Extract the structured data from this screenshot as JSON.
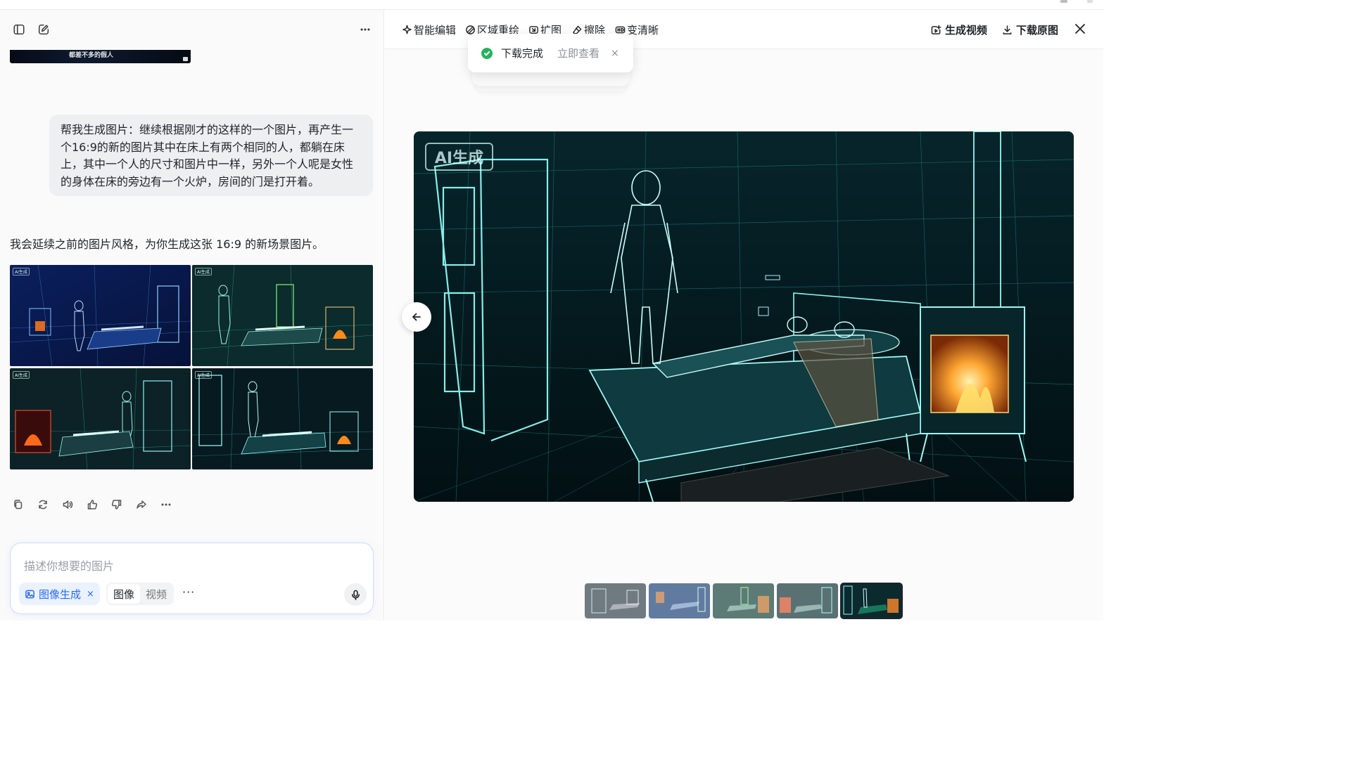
{
  "left": {
    "prev_thumb_caption": "都差不多的假人",
    "user_message": "帮我生成图片：继续根据刚才的这样的一个图片，再产生一个16:9的新的图片其中在床上有两个相同的人，都躺在床上，其中一个人的尺寸和图片中一样，另外一个人呢是女性的身体在床的旁边有一个火炉，房间的门是打开着。",
    "assistant_message": "我会延续之前的图片风格，为你生成这张 16:9 的新场景图片。",
    "image_watermark": "AI生成",
    "action_icons": [
      "copy-icon",
      "regenerate-icon",
      "speaker-icon",
      "thumbs-up-icon",
      "thumbs-down-icon",
      "share-icon",
      "more-icon"
    ],
    "composer": {
      "placeholder": "描述你想要的图片",
      "chip_label": "图像生成",
      "chip_close": "×",
      "seg_image": "图像",
      "seg_video": "视频",
      "more": "···"
    }
  },
  "right": {
    "tools": {
      "smart_edit": "智能编辑",
      "region_redraw": "区域重绘",
      "expand": "扩图",
      "erase": "擦除",
      "sharpen": "变清晰"
    },
    "generate_video": "生成视频",
    "download_original": "下载原图",
    "toast": {
      "message": "下载完成",
      "action": "立即查看",
      "close": "×"
    },
    "watermark": "AI生成",
    "colors": {
      "accent": "#2b6cf0",
      "success": "#22b35e",
      "wireframe": "#5ff3ea"
    }
  }
}
